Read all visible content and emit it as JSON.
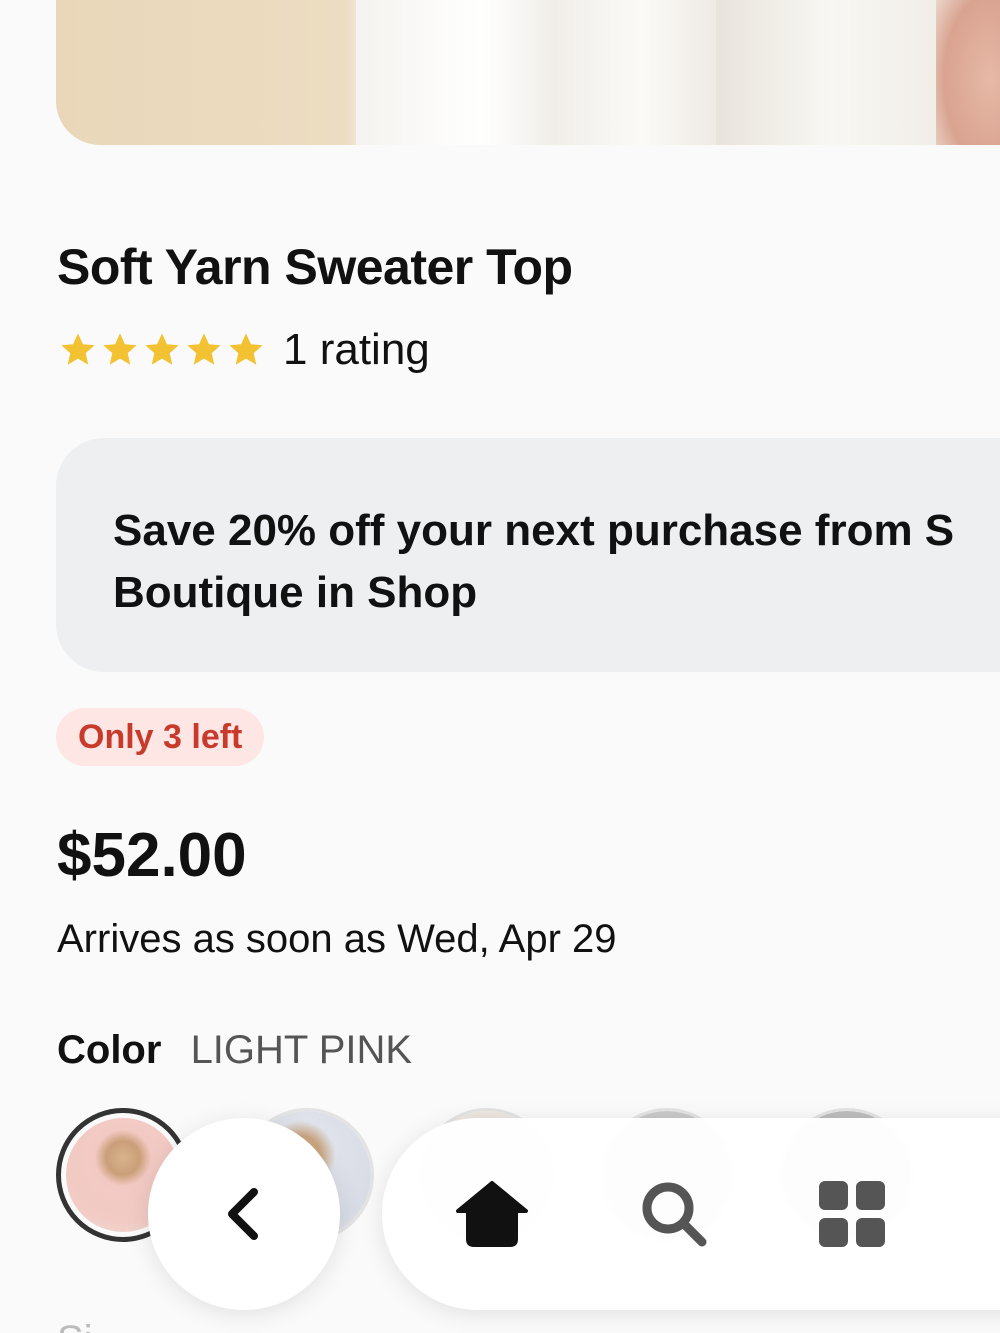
{
  "product": {
    "title": "Soft Yarn Sweater Top",
    "rating_stars": 5,
    "rating_text": "1 rating",
    "promo_line1": "Save 20% off your next purchase from S",
    "promo_line2": "Boutique in Shop",
    "stock_badge": "Only 3 left",
    "price": "$52.00",
    "arrival": "Arrives as soon as Wed, Apr 29",
    "color_label": "Color",
    "color_value": "LIGHT PINK",
    "next_section_label": "Si"
  },
  "colors": {
    "star": "#f2c232",
    "badge_bg": "#fde6e4",
    "badge_text": "#c83a2b",
    "promo_bg": "#eeeff1"
  },
  "swatches": [
    {
      "name": "light-pink",
      "selected": true
    },
    {
      "name": "light-blue",
      "selected": false
    },
    {
      "name": "cream",
      "selected": false
    },
    {
      "name": "gray",
      "selected": false
    },
    {
      "name": "dark-gray",
      "selected": false
    }
  ],
  "nav": {
    "back_icon": "chevron-left-icon",
    "home_icon": "home-icon",
    "search_icon": "search-icon",
    "grid_icon": "grid-icon"
  }
}
